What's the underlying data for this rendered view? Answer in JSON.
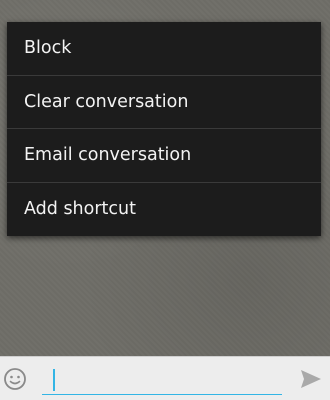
{
  "menu": {
    "items": [
      {
        "label": "Block"
      },
      {
        "label": "Clear conversation"
      },
      {
        "label": "Email conversation"
      },
      {
        "label": "Add shortcut"
      }
    ]
  },
  "composer": {
    "emoji_icon": "emoji-icon",
    "send_icon": "send-icon",
    "input_value": ""
  },
  "colors": {
    "menu_background": "#1c1c1c",
    "menu_text": "#f3f3f3",
    "accent": "#33b5e5",
    "input_bar_background": "#ededed"
  }
}
